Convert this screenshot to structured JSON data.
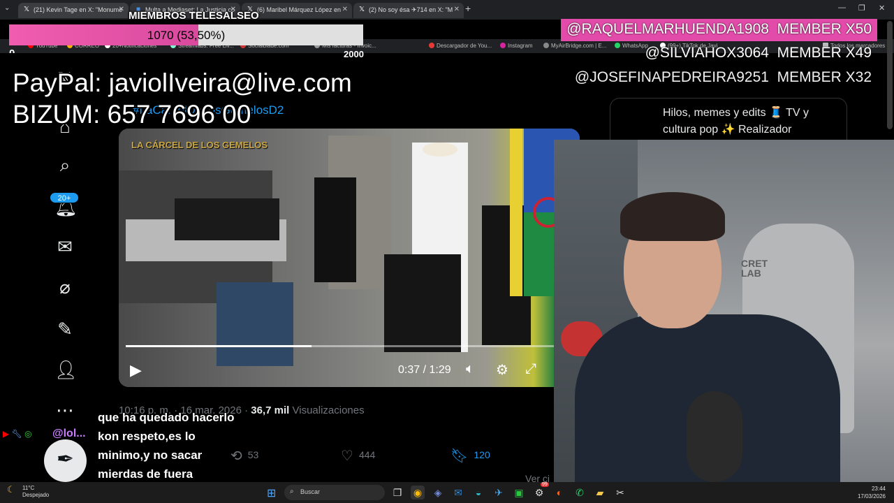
{
  "browser": {
    "tabs": [
      {
        "label": "(21) Kevin Tage en X: \"Monume",
        "icon": "x-logo-icon"
      },
      {
        "label": "Multa a Mediaset: La Justicia co",
        "icon": "news-icon"
      },
      {
        "label": "(6) Maribel Márquez López en",
        "icon": "x-logo-icon"
      },
      {
        "label": "(2) No soy ésa ✈714 en X: \"M",
        "icon": "x-logo-icon"
      }
    ],
    "new_tab": "+",
    "bookmarks": [
      "YouTube",
      "CORREO",
      "20+Notificaciones",
      "Streamlabs: Free Liv...",
      "Socialblade.com",
      "Mis facturas - Invoic...",
      "Descargador de You...",
      "Instagram",
      "MyAirBridge.com | E...",
      "WhatsApp",
      "(99+) TikTok de Javi",
      "Todos los marcadores"
    ]
  },
  "overlay": {
    "goal_title": "MIEMBROS TELESALSEO",
    "goal_text": "1070 (53,50%)",
    "goal_fraction": 0.535,
    "goal_min": "0",
    "goal_max": "2000",
    "paypal": "PayPal: javiolIveira@live.com",
    "bizum": "BIZUM: 657 7696 00",
    "members": [
      {
        "name": "@RAQUELMARHUENDA1908",
        "level": "MEMBER X50"
      },
      {
        "name": "@SILVIAHOX3064",
        "level": "MEMBER X49"
      },
      {
        "name": "@JOSEFINAPEDREIRA9251",
        "level": "MEMBER X32"
      }
    ]
  },
  "x_app": {
    "notifications_badge": "20+",
    "tweet_link": "#LaCarcelDeLosGemelosD2",
    "video": {
      "logo": "LA CÁRCEL DE LOS GEMELOS",
      "current_time": "0:37",
      "duration": "1:29",
      "time_display": "0:37 / 1:29",
      "progress_fraction": 0.416
    },
    "meta": {
      "timestamp": "10:16 p. m. · 16 mar. 2026 ·",
      "views_count": "36,7 mil",
      "views_label": "Visualizaciones"
    },
    "actions": {
      "retweets": "53",
      "likes": "444",
      "bookmarks": "120"
    },
    "see_more": "Ver ci",
    "bio": "Hilos, memes y edits 🧵 TV y cultura pop ✨ Realizador"
  },
  "chat": {
    "user": "@lol...",
    "message": "que ha quedado hacerlo kon respeto,es lo minimo,y no sacar mierdas de fuera"
  },
  "taskbar": {
    "weather_temp": "11°C",
    "weather_desc": "Despejado",
    "search_placeholder": "Buscar",
    "time": "23:44",
    "date": "17/03/2026",
    "discord_badge": "99"
  },
  "colors": {
    "x_blue": "#1d9bf0",
    "goal_pink": "#e24ba9",
    "taskbar": "#1c1c1c"
  }
}
